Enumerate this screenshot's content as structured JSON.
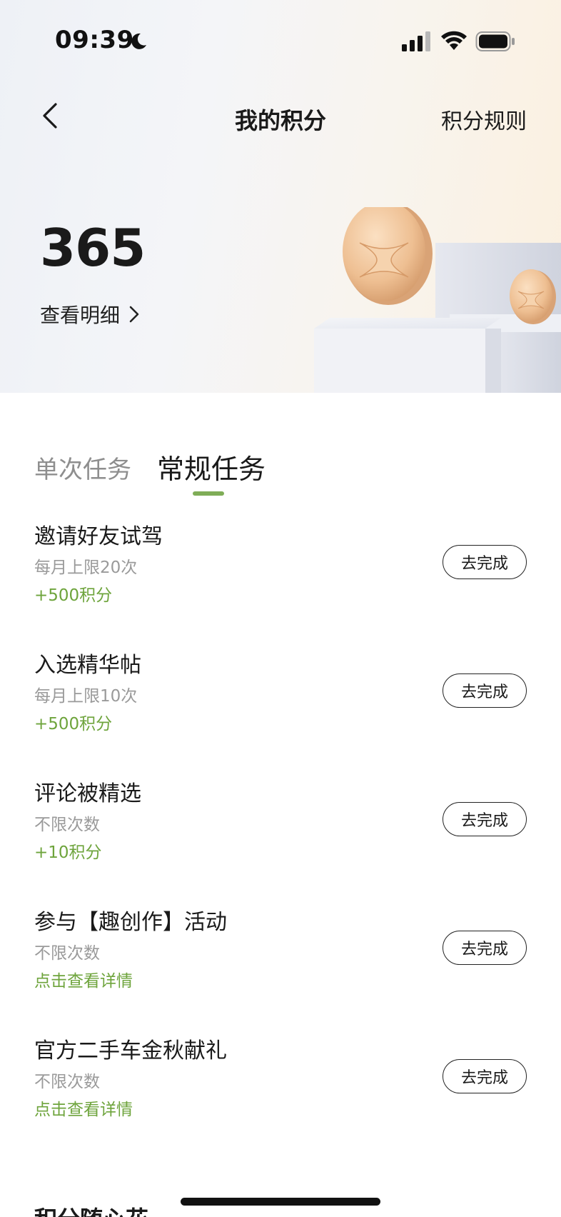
{
  "status_bar": {
    "time": "09:39",
    "icons": [
      "moon-icon",
      "signal-icon",
      "wifi-icon",
      "battery-icon"
    ]
  },
  "nav": {
    "back_icon": "chevron-left-icon",
    "title": "我的积分",
    "rules_link": "积分规则"
  },
  "summary": {
    "points": "365",
    "view_detail": "查看明细",
    "detail_icon": "chevron-right-icon"
  },
  "tabs": [
    {
      "label": "单次任务",
      "active": false
    },
    {
      "label": "常规任务",
      "active": true
    }
  ],
  "tasks": [
    {
      "title": "邀请好友试驾",
      "limit": "每月上限20次",
      "reward": "+500积分",
      "button": "去完成"
    },
    {
      "title": "入选精华帖",
      "limit": "每月上限10次",
      "reward": "+500积分",
      "button": "去完成"
    },
    {
      "title": "评论被精选",
      "limit": "不限次数",
      "reward": "+10积分",
      "button": "去完成"
    },
    {
      "title": "参与【趣创作】活动",
      "limit": "不限次数",
      "reward": "点击查看详情",
      "button": "去完成"
    },
    {
      "title": "官方二手车金秋献礼",
      "limit": "不限次数",
      "reward": "点击查看详情",
      "button": "去完成"
    }
  ],
  "next_section_title": "积分随心花",
  "colors": {
    "accent_green": "#7fad57",
    "reward_green": "#6ea43c",
    "coin_gold": "#e8b98c"
  }
}
